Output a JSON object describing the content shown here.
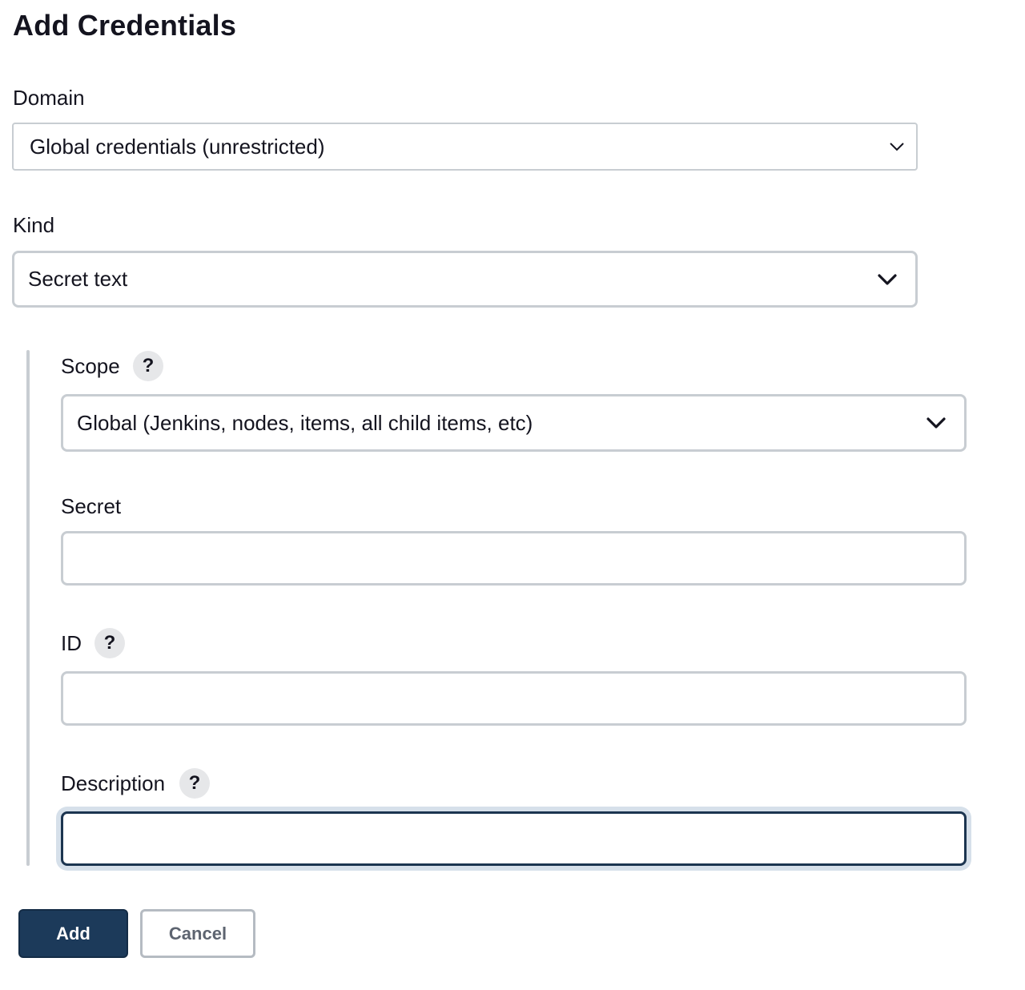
{
  "page": {
    "title": "Add Credentials"
  },
  "domain": {
    "label": "Domain",
    "selected": "Global credentials (unrestricted)",
    "icon": "chevron-down-icon"
  },
  "kind": {
    "label": "Kind",
    "selected": "Secret text",
    "icon": "chevron-down-icon"
  },
  "scope": {
    "label": "Scope",
    "help": "?",
    "selected": "Global (Jenkins, nodes, items, all child items, etc)",
    "icon": "chevron-down-icon"
  },
  "secret": {
    "label": "Secret",
    "value": ""
  },
  "id_field": {
    "label": "ID",
    "help": "?",
    "value": ""
  },
  "description": {
    "label": "Description",
    "help": "?",
    "value": ""
  },
  "buttons": {
    "add": "Add",
    "cancel": "Cancel"
  },
  "colors": {
    "primary": "#1c3a5a",
    "border": "#c8cdd2",
    "focus": "#1c3550"
  }
}
